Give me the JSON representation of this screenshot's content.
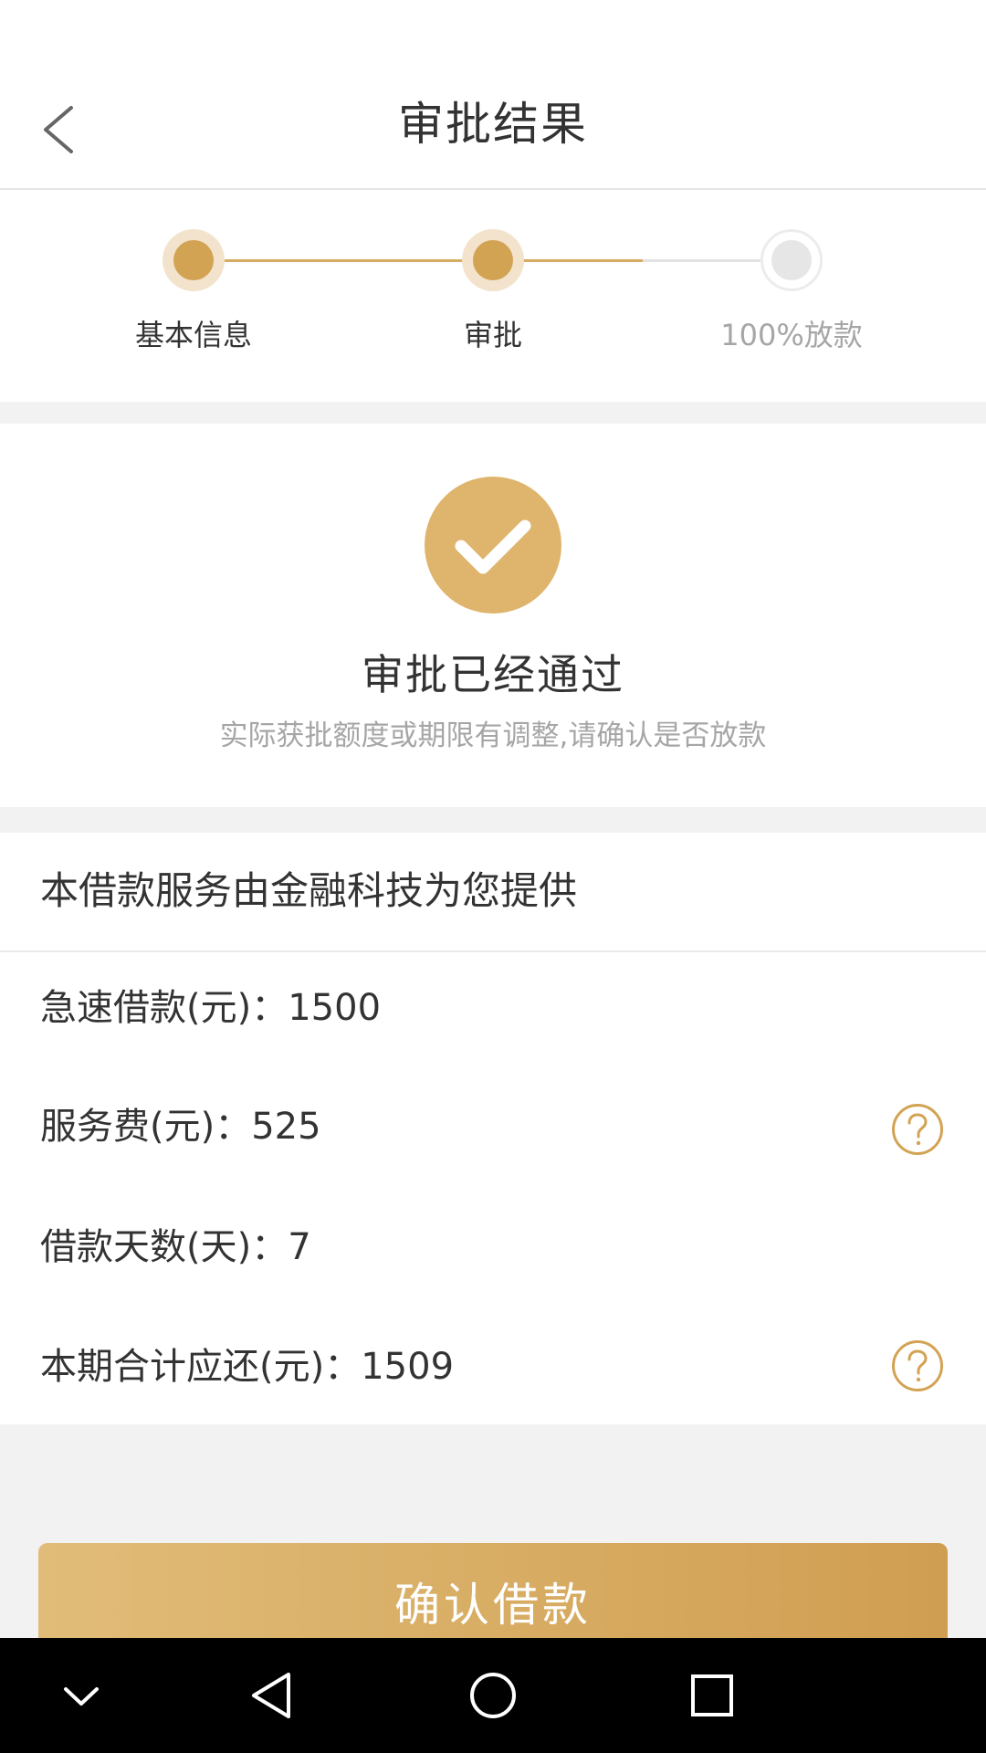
{
  "header": {
    "title": "审批结果",
    "back_icon": "chevron-left-icon"
  },
  "steps": [
    {
      "label": "基本信息",
      "state": "done"
    },
    {
      "label": "审批",
      "state": "done"
    },
    {
      "label": "100%放款",
      "state": "pending"
    }
  ],
  "result": {
    "icon": "check-icon",
    "title": "审批已经通过",
    "subtitle": "实际获批额度或期限有调整,请确认是否放款"
  },
  "info": {
    "provider": "本借款服务由金融科技为您提供",
    "rows": [
      {
        "label": "急速借款(元)：",
        "value": "1500",
        "help": false
      },
      {
        "label": "服务费(元)：",
        "value": "525",
        "help": true
      },
      {
        "label": "借款天数(天)：",
        "value": "7",
        "help": false
      },
      {
        "label": "本期合计应还(元)：",
        "value": "1509",
        "help": true
      }
    ],
    "help_icon": "question-circle-icon"
  },
  "confirm_button": {
    "label": "确认借款"
  },
  "nav_bar": {
    "buttons": [
      "chevron-down-icon",
      "back-triangle-icon",
      "home-circle-icon",
      "recents-square-icon"
    ]
  },
  "colors": {
    "accent": "#d3a354",
    "accent_light": "#f3e3cc",
    "check_bg": "#dfb56e",
    "text_primary": "#333333",
    "text_secondary": "#a6a6a6",
    "inactive": "#e6e6e6",
    "background": "#f2f2f2"
  }
}
